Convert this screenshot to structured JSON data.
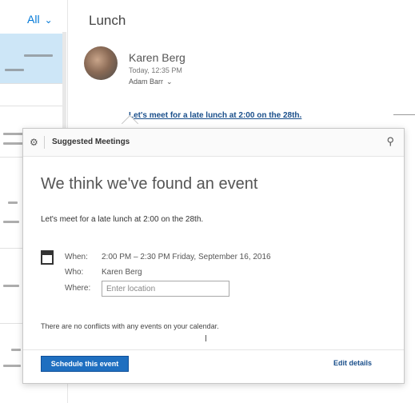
{
  "list": {
    "filter_label": "All",
    "filter_chevron": "⌄"
  },
  "message": {
    "subject": "Lunch",
    "sender": "Karen Berg",
    "sent": "Today, 12:35 PM",
    "recipients": "Adam Barr",
    "recipients_chevron": "⌄",
    "body": "Let's meet for a late lunch at 2:00 on the 28th."
  },
  "popup": {
    "header_icon": "⚙",
    "header_title": "Suggested Meetings",
    "pin_icon": "⚲",
    "heading": "We think we've found an event",
    "sentence": "Let's meet for a late lunch at 2:00 on the 28th.",
    "when_label": "When:",
    "when_value": "2:00 PM – 2:30 PM Friday, September 16, 2016",
    "who_label": "Who:",
    "who_value": "Karen Berg",
    "where_label": "Where:",
    "where_placeholder": "Enter location",
    "conflicts_text": "There are no conflicts with any events on your calendar.",
    "schedule_button": "Schedule this event",
    "edit_details": "Edit details"
  },
  "colors": {
    "accent": "#1f6fc0",
    "selected_item": "#cde6f7"
  }
}
